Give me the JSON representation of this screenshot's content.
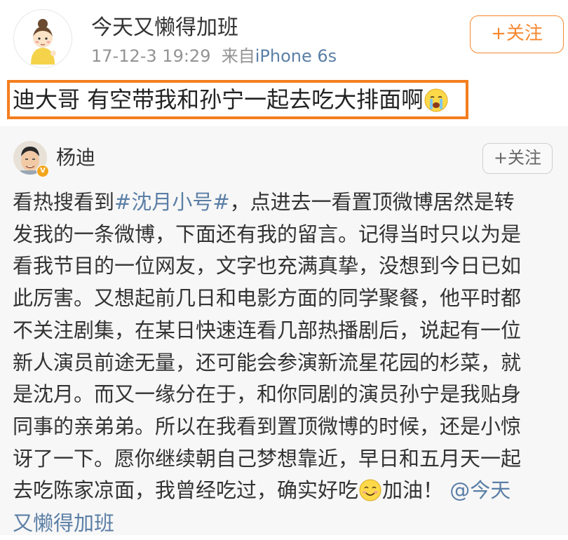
{
  "post": {
    "author": "今天又懒得加班",
    "date": "17-12-3 19:29",
    "source_prefix": "来自",
    "source_device": "iPhone 6s",
    "follow_label": "+关注",
    "text": "迪大哥 有空带我和孙宁一起去吃大排面啊",
    "emoji": "crying-face-emoji"
  },
  "repost": {
    "author": "杨迪",
    "follow_label": "+关注",
    "lines": [
      [
        "看热搜看到",
        "#沈月小号#",
        "，点进去一看置顶微博居然是转"
      ],
      [
        "发我的一条微博，下面还有我的留言。记得当时只以为是"
      ],
      [
        "看我节目的一位网友，文字也充满真挚，没想到今日已如"
      ],
      [
        "此厉害。又想起前几日和电影方面的同学聚餐，他平时都"
      ],
      [
        "不关注剧集，在某日快速连看几部热播剧后，说起有一位"
      ],
      [
        "新人演员前途无量，还可能会参演新流星花园的杉菜，就"
      ],
      [
        "是沈月。而又一缘分在于，和你同剧的演员孙宁是我贴身"
      ],
      [
        "同事的亲弟弟。所以在我看到置顶微博的时候，还是小惊"
      ],
      [
        "讶了一下。愿你继续朝自己梦想靠近，早日和五月天一起"
      ],
      [
        "去吃陈家凉面，我曾经吃过，确实好吃",
        "加油！",
        "@今天"
      ],
      [
        "又懒得加班"
      ]
    ],
    "emoji": "smiling-face-emoji",
    "badge": "V"
  },
  "colors": {
    "accent_orange": "#f47e1f",
    "link_blue": "#5b7fa6",
    "meta_gray": "#939393"
  }
}
